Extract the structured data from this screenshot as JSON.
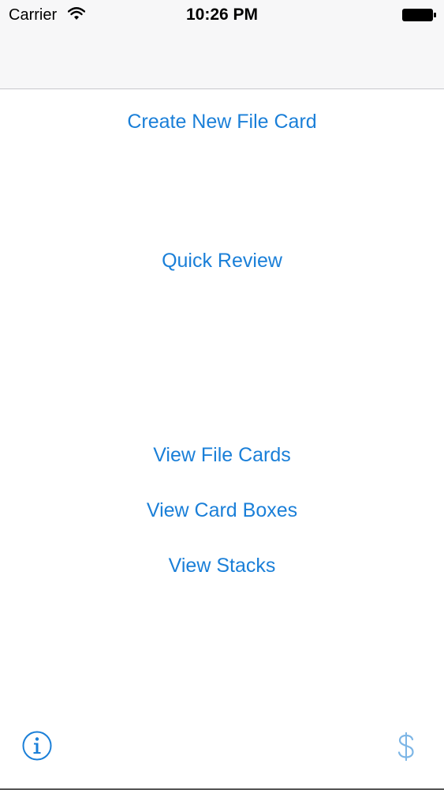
{
  "status_bar": {
    "carrier": "Carrier",
    "time": "10:26 PM",
    "icons": [
      "wifi-icon",
      "battery-icon"
    ]
  },
  "menu": {
    "create_new_file_card": "Create New File Card",
    "quick_review": "Quick Review",
    "view_file_cards": "View File Cards",
    "view_card_boxes": "View Card Boxes",
    "view_stacks": "View Stacks"
  },
  "toolbar": {
    "left_icon": "info-icon",
    "right_icon": "dollar-icon"
  },
  "colors": {
    "accent": "#1a7fd8",
    "accent_light": "#7db6e6",
    "nav_background": "#f7f7f8",
    "background": "#ffffff"
  }
}
